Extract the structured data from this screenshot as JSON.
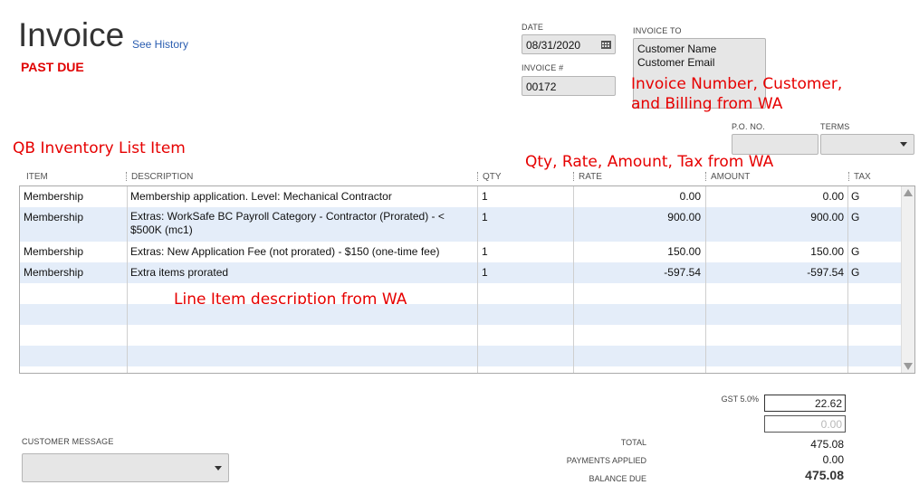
{
  "header": {
    "title": "Invoice",
    "see_history": "See History",
    "status": "PAST DUE"
  },
  "date": {
    "label": "DATE",
    "value": "08/31/2020"
  },
  "invoice_no": {
    "label": "INVOICE #",
    "value": "00172"
  },
  "invoice_to": {
    "label": "INVOICE TO",
    "line1": "Customer Name",
    "line2": "Customer Email"
  },
  "po": {
    "label": "P.O. NO.",
    "value": ""
  },
  "terms": {
    "label": "TERMS",
    "value": ""
  },
  "annotations": {
    "invoice": "Invoice Number, Customer,",
    "invoice2": "and Billing from WA",
    "inventory": "QB Inventory List Item",
    "qty": "Qty, Rate, Amount, Tax from WA",
    "line": "Line Item description from WA"
  },
  "table": {
    "columns": {
      "item": "ITEM",
      "description": "DESCRIPTION",
      "qty": "QTY",
      "rate": "RATE",
      "amount": "AMOUNT",
      "tax": "TAX"
    },
    "rows": [
      {
        "item": "Membership",
        "description": "Membership application. Level: Mechanical Contractor",
        "description2": "",
        "qty": "1",
        "rate": "0.00",
        "amount": "0.00",
        "tax": "G"
      },
      {
        "item": "Membership",
        "description": "Extras: WorkSafe BC Payroll Category - Contractor (Prorated) - <",
        "description2": "$500K (mc1)",
        "qty": "1",
        "rate": "900.00",
        "amount": "900.00",
        "tax": "G"
      },
      {
        "item": "Membership",
        "description": "Extras: New Application Fee (not prorated) - $150 (one-time fee)",
        "description2": "",
        "qty": "1",
        "rate": "150.00",
        "amount": "150.00",
        "tax": "G"
      },
      {
        "item": "Membership",
        "description": "Extra items prorated",
        "description2": "",
        "qty": "1",
        "rate": "-597.54",
        "amount": "-597.54",
        "tax": "G"
      }
    ]
  },
  "customer_message": {
    "label": "CUSTOMER MESSAGE",
    "value": ""
  },
  "totals": {
    "gst_label": "GST 5.0%",
    "gst_value": "22.62",
    "placeholder": "0.00",
    "total_label": "TOTAL",
    "total_value": "475.08",
    "payments_label": "PAYMENTS APPLIED",
    "payments_value": "0.00",
    "balance_label": "BALANCE DUE",
    "balance_value": "475.08"
  },
  "colors": {
    "accent": "#2a5db0",
    "alert": "#e00000",
    "annotation": "#e60000",
    "row_alt": "#e4edf9"
  }
}
